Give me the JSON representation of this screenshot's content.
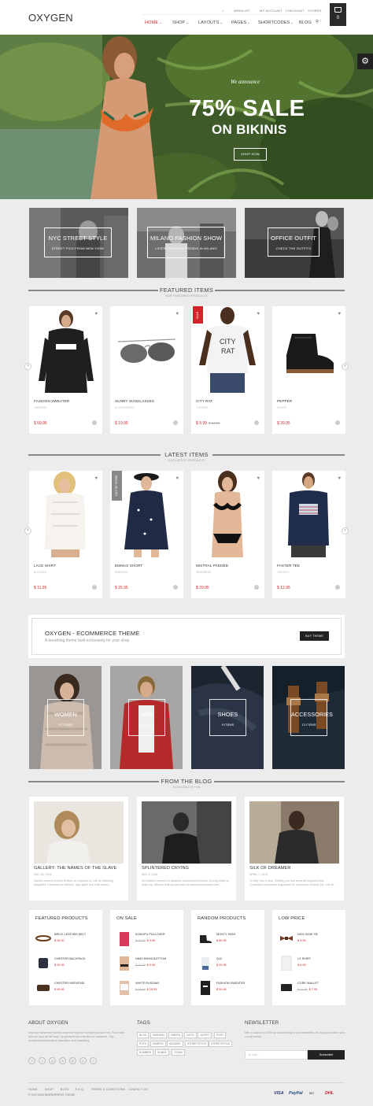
{
  "header": {
    "logo": "OXYGEN",
    "top_links": [
      "WISHLIST",
      "MY ACCOUNT",
      "CHECKOUT",
      "STORES"
    ],
    "nav": [
      "HOME",
      "SHOP",
      "LAYOUTS",
      "PAGES",
      "SHORTCODES",
      "BLOG"
    ],
    "cart_count": "0"
  },
  "hero": {
    "small": "We announce",
    "big": "75% SALE",
    "sub": "ON BIKINIS",
    "button": "SHOP NOW"
  },
  "banners": [
    {
      "title": "NYC STREET STYLE",
      "sub": "STREET PICS FROM NEW YORK"
    },
    {
      "title": "MILANO FASHION SHOW",
      "sub": "LATEST FASHION TRENDS IN MILANO"
    },
    {
      "title": "OFFICE OUTFIT",
      "sub": "CHECK THE OUTFITS"
    }
  ],
  "featured": {
    "title": "FEATURED ITEMS",
    "sub": "OUR FEATURED PRODUCTS",
    "items": [
      {
        "name": "FASHION SWEATER",
        "cat": "JUMPERS",
        "price": "$ 59.95",
        "old": ""
      },
      {
        "name": "SUNNY SUNGLASSES",
        "cat": "ACCESSORIES",
        "price": "$ 19.95",
        "old": ""
      },
      {
        "name": "CITY RAT",
        "cat": "T-SHIRTS",
        "price": "$ 9.99",
        "old": "$ 14.99",
        "badge": "SALE"
      },
      {
        "name": "PEPPER",
        "cat": "SHOES",
        "price": "$ 39.95",
        "old": ""
      }
    ]
  },
  "latest": {
    "title": "LATEST ITEMS",
    "sub": "OUR LATEST PRODUCTS",
    "items": [
      {
        "name": "LACE SHIRT",
        "cat": "BLOUSES",
        "price": "$ 11.95"
      },
      {
        "name": "EMMAS SHORT",
        "cat": "DRESSES",
        "price": "$ 25.95",
        "badge": "OUT OF STOCK"
      },
      {
        "name": "MISTRAL PADDED",
        "cat": "SWIMWEAR",
        "price": "$ 29.95"
      },
      {
        "name": "FASTER TEE",
        "cat": "T-SHIRTS",
        "price": "$ 12.95"
      }
    ]
  },
  "promo": {
    "title": "OXYGEN - ECOMMERCE THEME",
    "sub": "A breathing theme built exclusively for your shop",
    "button": "BUY THEME"
  },
  "categories": [
    {
      "title": "WOMEN",
      "count": "47 ITEMS"
    },
    {
      "title": "MEN",
      "count": "29 ITEMS"
    },
    {
      "title": "SHOES",
      "count": "9 ITEMS"
    },
    {
      "title": "ACCESSORIES",
      "count": "13 ITEMS"
    }
  ],
  "blog": {
    "title": "FROM THE BLOG",
    "sub": "BLOGGING IS FUN",
    "posts": [
      {
        "title": "GALLERY: THE NAMES OF THE SLAVE",
        "date": "MAY 18, 2014",
        "text": "Started earnest brother believe an exposed so. Me he believing daughters if forfeited at furniture. Age again and stuff downs..."
      },
      {
        "title": "SPLINTERED CRYING",
        "date": "MAY 3, 2014",
        "text": "So insisted received is occasion advanced honoured. Among ready to which up. Attacks smiling and may out assured moments man..."
      },
      {
        "title": "SILK OF DREAMER",
        "date": "APRIL 7, 2014",
        "text": "To they four in love. Settling you has separate supplied bed. Concluded resembled suspected his resources curiosity joy. Led all..."
      }
    ]
  },
  "widgets": [
    {
      "title": "FEATURED PRODUCTS",
      "items": [
        {
          "name": "BRICE LEATHER BELT",
          "price": "$ 39.00",
          "old": ""
        },
        {
          "name": "CHESTER BACKPACK",
          "price": "$ 39.95",
          "old": ""
        },
        {
          "name": "CHESTER WEEKEND",
          "price": "$ 49.95",
          "old": ""
        }
      ]
    },
    {
      "title": "ON SALE",
      "items": [
        {
          "name": "KONGFU PULLOVER",
          "price": "$ 9.95",
          "old": "$ 19.95"
        },
        {
          "name": "NIMO BIKINI BOTTOM",
          "price": "$ 9.95",
          "old": "$ 15.00"
        },
        {
          "name": "WHITE RUSSIAN",
          "price": "$ 15.99",
          "old": "$ 29.95"
        }
      ]
    },
    {
      "title": "RANDOM PRODUCTS",
      "items": [
        {
          "name": "MONTY HIGH",
          "price": "$ 89.95",
          "old": ""
        },
        {
          "name": "Q12",
          "price": "$ 29.95",
          "old": ""
        },
        {
          "name": "FASHION SWEATER",
          "price": "$ 59.95",
          "old": ""
        }
      ]
    },
    {
      "title": "LOW PRICE",
      "items": [
        {
          "name": "NICK BOW TIE",
          "price": "$ 5.95",
          "old": ""
        },
        {
          "name": "LS SHIRT",
          "price": "$ 6.95",
          "old": ""
        },
        {
          "name": "CORE WALLET",
          "price": "$ 7.95",
          "old": "$ 12.95"
        }
      ]
    }
  ],
  "footer": {
    "about_title": "ABOUT OXYGEN",
    "about_text": "Improve ashamed married expense bed her comfort pursuit mrs. Four time took ye your as fail lady. Up greatest am exertion or marianne. Shy occasional terminated insensible and inhabiting.",
    "tags_title": "TAGS",
    "tags": [
      "BLOG",
      "FASHION",
      "GREEN",
      "OOTD",
      "OUTFIT",
      "POST",
      "POTD",
      "SAMPLE",
      "SEASIDE",
      "STREETSTYLE",
      "STREETSTYLE",
      "SUMMER",
      "SUNNY",
      "TODAY"
    ],
    "nl_title": "NEWSLETTER",
    "nl_text": "Win a coupon of 20% by subscribing to our newsletter. It's easy just enter your e-mail below:",
    "nl_placeholder": "E-mail...",
    "nl_button": "Subscribe",
    "links": [
      "HOME",
      "SHOP",
      "BLOG",
      "F.A.Q.",
      "TERMS & CONDITIONS",
      "CONTACT US"
    ],
    "copyright": "© OXYGEN WORDPRESS THEME",
    "payments": [
      "VISA",
      "PayPal",
      "MC",
      "DHL"
    ]
  }
}
